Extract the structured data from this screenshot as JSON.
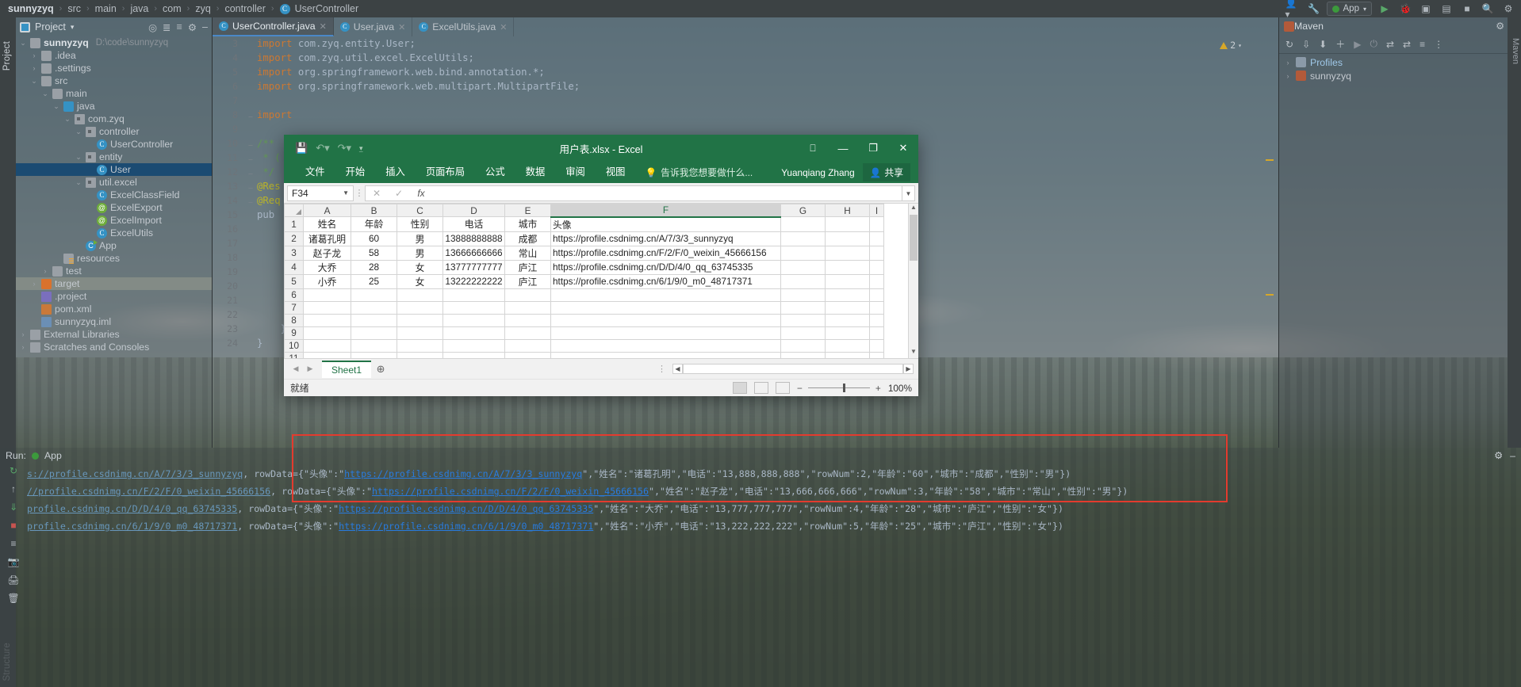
{
  "breadcrumb": {
    "items": [
      "sunnyzyq",
      "src",
      "main",
      "java",
      "com",
      "zyq",
      "controller",
      "UserController"
    ],
    "separator": "›"
  },
  "topbar": {
    "run_config": "App",
    "search_icon": "search-icon",
    "settings_icon": "gear-icon"
  },
  "left_strip": {
    "project_label": "Project",
    "structure_label": "Structure"
  },
  "project_panel": {
    "title": "Project",
    "chevron": "▾",
    "tree": [
      {
        "indent": 0,
        "arrow": "⌄",
        "icon": "module-folder",
        "label": "sunnyzyq",
        "bold": true,
        "dim": "D:\\code\\sunnyzyq"
      },
      {
        "indent": 1,
        "arrow": "›",
        "icon": "folder",
        "label": ".idea"
      },
      {
        "indent": 1,
        "arrow": "›",
        "icon": "folder",
        "label": ".settings"
      },
      {
        "indent": 1,
        "arrow": "⌄",
        "icon": "folder",
        "label": "src"
      },
      {
        "indent": 2,
        "arrow": "⌄",
        "icon": "folder",
        "label": "main"
      },
      {
        "indent": 3,
        "arrow": "⌄",
        "icon": "folder-blue",
        "label": "java"
      },
      {
        "indent": 4,
        "arrow": "⌄",
        "icon": "package",
        "label": "com.zyq"
      },
      {
        "indent": 5,
        "arrow": "⌄",
        "icon": "package",
        "label": "controller"
      },
      {
        "indent": 6,
        "arrow": "",
        "icon": "class",
        "label": "UserController"
      },
      {
        "indent": 5,
        "arrow": "⌄",
        "icon": "package",
        "label": "entity"
      },
      {
        "indent": 6,
        "arrow": "",
        "icon": "class",
        "label": "User",
        "selected": true
      },
      {
        "indent": 5,
        "arrow": "⌄",
        "icon": "package",
        "label": "util.excel"
      },
      {
        "indent": 6,
        "arrow": "",
        "icon": "class",
        "label": "ExcelClassField"
      },
      {
        "indent": 6,
        "arrow": "",
        "icon": "annotation",
        "label": "ExcelExport"
      },
      {
        "indent": 6,
        "arrow": "",
        "icon": "annotation",
        "label": "ExcelImport"
      },
      {
        "indent": 6,
        "arrow": "",
        "icon": "class",
        "label": "ExcelUtils"
      },
      {
        "indent": 5,
        "arrow": "",
        "icon": "app",
        "label": "App"
      },
      {
        "indent": 3,
        "arrow": "",
        "icon": "resources",
        "label": "resources"
      },
      {
        "indent": 2,
        "arrow": "›",
        "icon": "folder",
        "label": "test"
      },
      {
        "indent": 1,
        "arrow": "›",
        "icon": "folder-orange",
        "label": "target",
        "highlight": true
      },
      {
        "indent": 1,
        "arrow": "",
        "icon": "project-file",
        "label": ".project"
      },
      {
        "indent": 1,
        "arrow": "",
        "icon": "xml",
        "label": "pom.xml"
      },
      {
        "indent": 1,
        "arrow": "",
        "icon": "iml",
        "label": "sunnyzyq.iml"
      },
      {
        "indent": 0,
        "arrow": "›",
        "icon": "library",
        "label": "External Libraries"
      },
      {
        "indent": 0,
        "arrow": "›",
        "icon": "scratches",
        "label": "Scratches and Consoles"
      }
    ]
  },
  "editor": {
    "tabs": [
      {
        "label": "UserController.java",
        "active": true
      },
      {
        "label": "User.java",
        "active": false
      },
      {
        "label": "ExcelUtils.java",
        "active": false
      }
    ],
    "warning_count": "2",
    "lines": [
      {
        "no": "3",
        "code": "import com.zyq.entity.User;",
        "kind": "import"
      },
      {
        "no": "4",
        "code": "import com.zyq.util.excel.ExcelUtils;",
        "kind": "import"
      },
      {
        "no": "5",
        "code": "import org.springframework.web.bind.annotation.*;",
        "kind": "import"
      },
      {
        "no": "6",
        "code": "import org.springframework.web.multipart.MultipartFile;",
        "kind": "import"
      },
      {
        "no": "7",
        "code": "",
        "kind": "blank"
      },
      {
        "no": "8",
        "code": "import",
        "kind": "import"
      },
      {
        "no": "9",
        "code": "",
        "kind": "blank"
      },
      {
        "no": "10",
        "code": "/**",
        "kind": "comment"
      },
      {
        "no": "11",
        "code": " * (",
        "kind": "comment"
      },
      {
        "no": "12",
        "code": " */",
        "kind": "comment"
      },
      {
        "no": "13",
        "code": "@Res",
        "kind": "annotation"
      },
      {
        "no": "14",
        "code": "@Req",
        "kind": "annotation"
      },
      {
        "no": "15",
        "code": "pub",
        "kind": "code"
      },
      {
        "no": "16",
        "code": "",
        "kind": "blank"
      },
      {
        "no": "17",
        "code": "",
        "kind": "blank"
      },
      {
        "no": "18",
        "code": "",
        "kind": "blank"
      },
      {
        "no": "19",
        "code": "",
        "kind": "blank"
      },
      {
        "no": "20",
        "code": "",
        "kind": "blank"
      },
      {
        "no": "21",
        "code": "",
        "kind": "blank"
      },
      {
        "no": "22",
        "code": "",
        "kind": "blank"
      },
      {
        "no": "23",
        "code": "    }",
        "kind": "code"
      },
      {
        "no": "24",
        "code": "}",
        "kind": "code"
      }
    ]
  },
  "maven": {
    "title": "Maven",
    "vertical_label": "Maven",
    "items": [
      {
        "arrow": "›",
        "icon": "profiles-icon",
        "label": "Profiles"
      },
      {
        "arrow": "›",
        "icon": "module-icon",
        "label": "sunnyzyq"
      }
    ]
  },
  "excel": {
    "title": "用户表.xlsx - Excel",
    "quick_access": [
      "save-icon",
      "undo-icon",
      "redo-icon",
      "customize-icon"
    ],
    "window_controls": {
      "ribbon_display": "⬒",
      "minimize": "—",
      "maximize": "❐",
      "close": "✕"
    },
    "ribbon_tabs": [
      "文件",
      "开始",
      "插入",
      "页面布局",
      "公式",
      "数据",
      "审阅",
      "视图"
    ],
    "tell_me": "告诉我您想要做什么...",
    "user_name": "Yuanqiang Zhang",
    "share_label": "共享",
    "name_box": "F34",
    "formula_value": "",
    "formula_buttons": [
      "✕",
      "✓",
      "fx"
    ],
    "columns": [
      "A",
      "B",
      "C",
      "D",
      "E",
      "F",
      "G",
      "H",
      "I"
    ],
    "selected_column": "F",
    "headers": [
      "姓名",
      "年龄",
      "性别",
      "电话",
      "城市",
      "头像"
    ],
    "rows": [
      {
        "n": "1",
        "cells": [
          "姓名",
          "年龄",
          "性别",
          "电话",
          "城市",
          "头像"
        ]
      },
      {
        "n": "2",
        "cells": [
          "诸葛孔明",
          "60",
          "男",
          "13888888888",
          "成都",
          "https://profile.csdnimg.cn/A/7/3/3_sunnyzyq"
        ]
      },
      {
        "n": "3",
        "cells": [
          "赵子龙",
          "58",
          "男",
          "13666666666",
          "常山",
          "https://profile.csdnimg.cn/F/2/F/0_weixin_45666156"
        ]
      },
      {
        "n": "4",
        "cells": [
          "大乔",
          "28",
          "女",
          "13777777777",
          "庐江",
          "https://profile.csdnimg.cn/D/D/4/0_qq_63745335"
        ]
      },
      {
        "n": "5",
        "cells": [
          "小乔",
          "25",
          "女",
          "13222222222",
          "庐江",
          "https://profile.csdnimg.cn/6/1/9/0_m0_48717371"
        ]
      },
      {
        "n": "6",
        "cells": [
          "",
          "",
          "",
          "",
          "",
          ""
        ]
      },
      {
        "n": "7",
        "cells": [
          "",
          "",
          "",
          "",
          "",
          ""
        ]
      },
      {
        "n": "8",
        "cells": [
          "",
          "",
          "",
          "",
          "",
          ""
        ]
      },
      {
        "n": "9",
        "cells": [
          "",
          "",
          "",
          "",
          "",
          ""
        ]
      },
      {
        "n": "10",
        "cells": [
          "",
          "",
          "",
          "",
          "",
          ""
        ]
      },
      {
        "n": "11",
        "cells": [
          "",
          "",
          "",
          "",
          "",
          ""
        ]
      }
    ],
    "sheet_tab": "Sheet1",
    "add_sheet": "⊕",
    "status": "就绪",
    "zoom": "100%",
    "zoom_minus": "−",
    "zoom_plus": "+"
  },
  "run": {
    "title": "Run:",
    "config": "App",
    "console_lines": [
      {
        "prefix": "s://profile.csdnimg.cn/A/7/3/3_sunnyzyq",
        "mid": ", rowData={\"头像\":\"",
        "url": "https://profile.csdnimg.cn/A/7/3/3_sunnyzyq",
        "suffix": "\",\"姓名\":\"诸葛孔明\",\"电话\":\"13,888,888,888\",\"rowNum\":2,\"年龄\":\"60\",\"城市\":\"成都\",\"性别\":\"男\"})"
      },
      {
        "prefix": "//profile.csdnimg.cn/F/2/F/0_weixin_45666156",
        "mid": ", rowData={\"头像\":\"",
        "url": "https://profile.csdnimg.cn/F/2/F/0_weixin_45666156",
        "suffix": "\",\"姓名\":\"赵子龙\",\"电话\":\"13,666,666,666\",\"rowNum\":3,\"年龄\":\"58\",\"城市\":\"常山\",\"性别\":\"男\"})"
      },
      {
        "prefix": "profile.csdnimg.cn/D/D/4/0_qq_63745335",
        "mid": ", rowData={\"头像\":\"",
        "url": "https://profile.csdnimg.cn/D/D/4/0_qq_63745335",
        "suffix": "\",\"姓名\":\"大乔\",\"电话\":\"13,777,777,777\",\"rowNum\":4,\"年龄\":\"28\",\"城市\":\"庐江\",\"性别\":\"女\"})"
      },
      {
        "prefix": "profile.csdnimg.cn/6/1/9/0_m0_48717371",
        "mid": ", rowData={\"头像\":\"",
        "url": "https://profile.csdnimg.cn/6/1/9/0_m0_48717371",
        "suffix": "\",\"姓名\":\"小乔\",\"电话\":\"13,222,222,222\",\"rowNum\":5,\"年龄\":\"25\",\"城市\":\"庐江\",\"性别\":\"女\"})"
      }
    ]
  },
  "colors": {
    "excel_green": "#217346",
    "ide_bg": "#3c4244",
    "selection_blue": "#1b4b72",
    "annotation_link": "#6897bb",
    "highlight_red": "#e33b2e"
  }
}
